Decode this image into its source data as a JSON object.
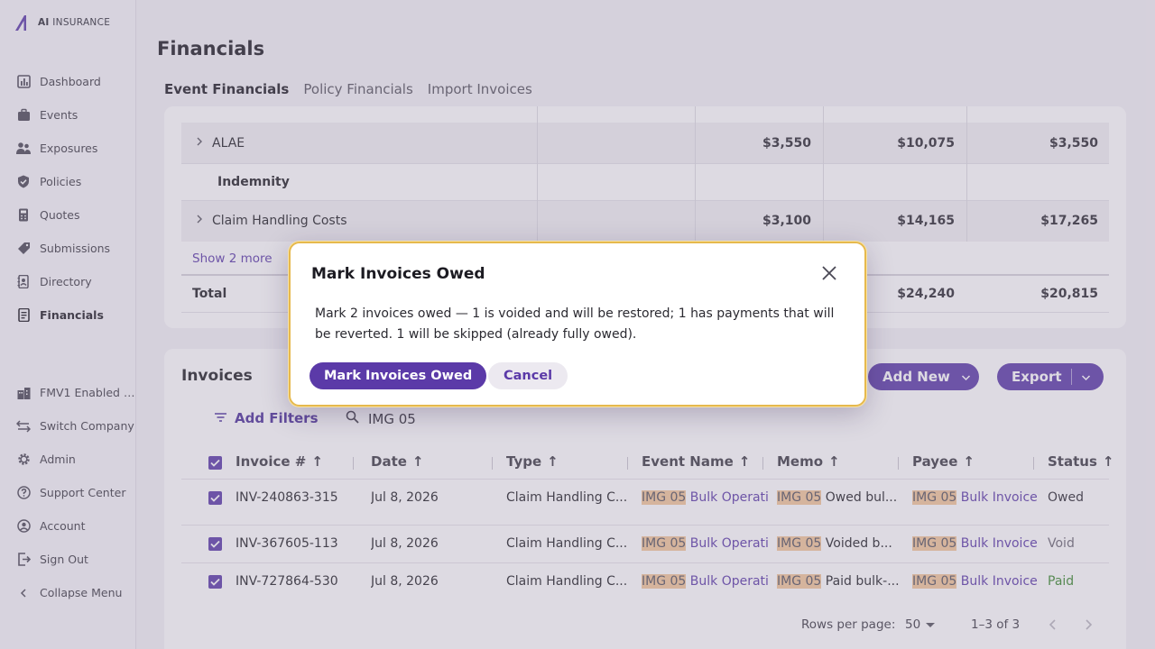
{
  "brand": {
    "logo_bold": "AI",
    "logo_rest": " INSURANCE"
  },
  "sidebar": {
    "items": [
      {
        "label": "Dashboard",
        "icon": "chart-icon"
      },
      {
        "label": "Events",
        "icon": "briefcase-icon"
      },
      {
        "label": "Exposures",
        "icon": "people-icon"
      },
      {
        "label": "Policies",
        "icon": "shield-icon"
      },
      {
        "label": "Quotes",
        "icon": "calculator-icon"
      },
      {
        "label": "Submissions",
        "icon": "tag-icon"
      },
      {
        "label": "Directory",
        "icon": "contacts-icon"
      },
      {
        "label": "Financials",
        "icon": "ledger-icon",
        "active": true
      }
    ],
    "bottom": [
      {
        "label": "FMV1 Enabled …",
        "icon": "building-icon"
      },
      {
        "label": "Switch Company",
        "icon": "switch-icon"
      },
      {
        "label": "Admin",
        "icon": "gear-icon"
      },
      {
        "label": "Support Center",
        "icon": "help-icon"
      },
      {
        "label": "Account",
        "icon": "user-icon"
      },
      {
        "label": "Sign Out",
        "icon": "signout-icon"
      },
      {
        "label": "Collapse Menu",
        "icon": "chevron-left-icon"
      }
    ]
  },
  "page": {
    "title": "Financials"
  },
  "tabs": [
    "Event Financials",
    "Policy Financials",
    "Import Invoices"
  ],
  "financials": {
    "rows": [
      {
        "label": "ALAE",
        "expand": true,
        "values": [
          "$3,550",
          "$10,075",
          "$3,550"
        ]
      },
      {
        "label": "Indemnity",
        "expand": false,
        "values": [
          "",
          "",
          ""
        ]
      },
      {
        "label": "Claim Handling Costs",
        "expand": true,
        "values": [
          "$3,100",
          "$14,165",
          "$17,265"
        ]
      }
    ],
    "show_more": "Show 2 more",
    "total_label": "Total",
    "total_values": [
      "$24,240",
      "$20,815"
    ]
  },
  "invoices": {
    "title": "Invoices",
    "add_new": "Add New",
    "export": "Export",
    "add_filters": "Add Filters",
    "search_value": "IMG 05",
    "columns": [
      "Invoice #",
      "Date",
      "Type",
      "Event Name",
      "Memo",
      "Payee",
      "Status"
    ],
    "rows": [
      {
        "invoice": "INV-240863-315",
        "date": "Jul 8, 2026",
        "type": "Claim Handling C...",
        "event_hl": "IMG 05",
        "event_rest": " Bulk Operatic",
        "memo_hl": "IMG 05",
        "memo_rest": " Owed bul...",
        "payee_hl": "IMG 05",
        "payee_rest": " Bulk Invoice V",
        "status": "Owed"
      },
      {
        "invoice": "INV-367605-113",
        "date": "Jul 8, 2026",
        "type": "Claim Handling C...",
        "event_hl": "IMG 05",
        "event_rest": " Bulk Operatic",
        "memo_hl": "IMG 05",
        "memo_rest": " Voided b...",
        "payee_hl": "IMG 05",
        "payee_rest": " Bulk Invoice V",
        "status": "Void"
      },
      {
        "invoice": "INV-727864-530",
        "date": "Jul 8, 2026",
        "type": "Claim Handling C...",
        "event_hl": "IMG 05",
        "event_rest": " Bulk Operatic",
        "memo_hl": "IMG 05",
        "memo_rest": " Paid bulk-...",
        "payee_hl": "IMG 05",
        "payee_rest": " Bulk Invoice V",
        "status": "Paid"
      }
    ],
    "rows_per_page_label": "Rows per page:",
    "rows_per_page": "50",
    "range": "1–3 of 3"
  },
  "modal": {
    "title": "Mark Invoices Owed",
    "body": "Mark 2 invoices owed — 1 is voided and will be restored; 1 has payments that will be reverted. 1 will be skipped (already fully owed).",
    "confirm": "Mark Invoices Owed",
    "cancel": "Cancel"
  },
  "colors": {
    "accent": "#5b3aa8",
    "highlight": "#f3c79a",
    "paid": "#3b8a2e",
    "modal_border": "#e6b94d"
  }
}
